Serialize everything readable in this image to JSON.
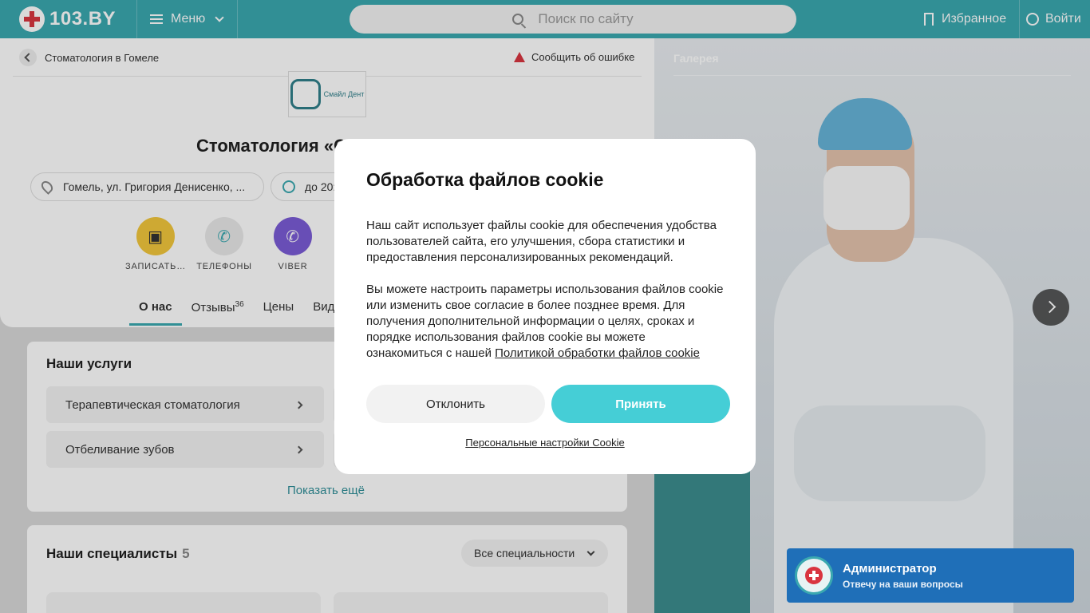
{
  "header": {
    "logo_text": "103.BY",
    "menu_label": "Меню",
    "search_placeholder": "Поиск по сайту",
    "favorites_label": "Избранное",
    "login_label": "Войти"
  },
  "breadcrumb": {
    "label": "Стоматология в Гомеле"
  },
  "report_label": "Сообщить об ошибке",
  "clinic": {
    "logo_text": "Смайл Дент",
    "title": "Стоматология «С… Д…",
    "address": "Гомель, ул. Григория Денисенко, ...",
    "hours": "до 20:"
  },
  "actions": [
    {
      "label": "ЗАПИСАТЬ…",
      "color": "#f2c73c",
      "icon": "calendar-icon"
    },
    {
      "label": "ТЕЛЕФОНЫ",
      "color": "#e9e9e9",
      "icon": "phone-icon"
    },
    {
      "label": "VIBER",
      "color": "#7b5cd6",
      "icon": "viber-icon"
    }
  ],
  "tabs": [
    {
      "label": "О нас",
      "active": true
    },
    {
      "label": "Отзывы",
      "count": "36"
    },
    {
      "label": "Цены"
    },
    {
      "label": "Вид"
    }
  ],
  "services": {
    "title": "Наши услуги",
    "items": [
      "Терапевтическая стоматология",
      "Отбеливание зубов"
    ],
    "more_label": "Показать ещё"
  },
  "specialists": {
    "title": "Наши специалисты",
    "count": "5",
    "filter_label": "Все специальности"
  },
  "gallery": {
    "label": "Галерея"
  },
  "admin_widget": {
    "title": "Администратор",
    "subtitle": "Отвечу на ваши вопросы"
  },
  "cookie_modal": {
    "title": "Обработка файлов cookie",
    "paragraph1": "Наш сайт использует файлы cookie для обеспечения удобства пользователей сайта, его улучшения, сбора статистики и предоставления персонализированных рекомендаций.",
    "paragraph2": "Вы можете настроить параметры использования файлов cookie или изменить свое согласие в более позднее время. Для получения дополнительной информации о целях, сроках и порядке использования файлов cookie вы можете ознакомиться с нашей ",
    "policy_link": "Политикой обработки файлов cookie",
    "decline_label": "Отклонить",
    "accept_label": "Принять",
    "settings_label": "Персональные настройки Cookie"
  },
  "colors": {
    "brand": "#3aa8b0",
    "accept": "#45ced6",
    "admin": "#1f6fb8"
  }
}
